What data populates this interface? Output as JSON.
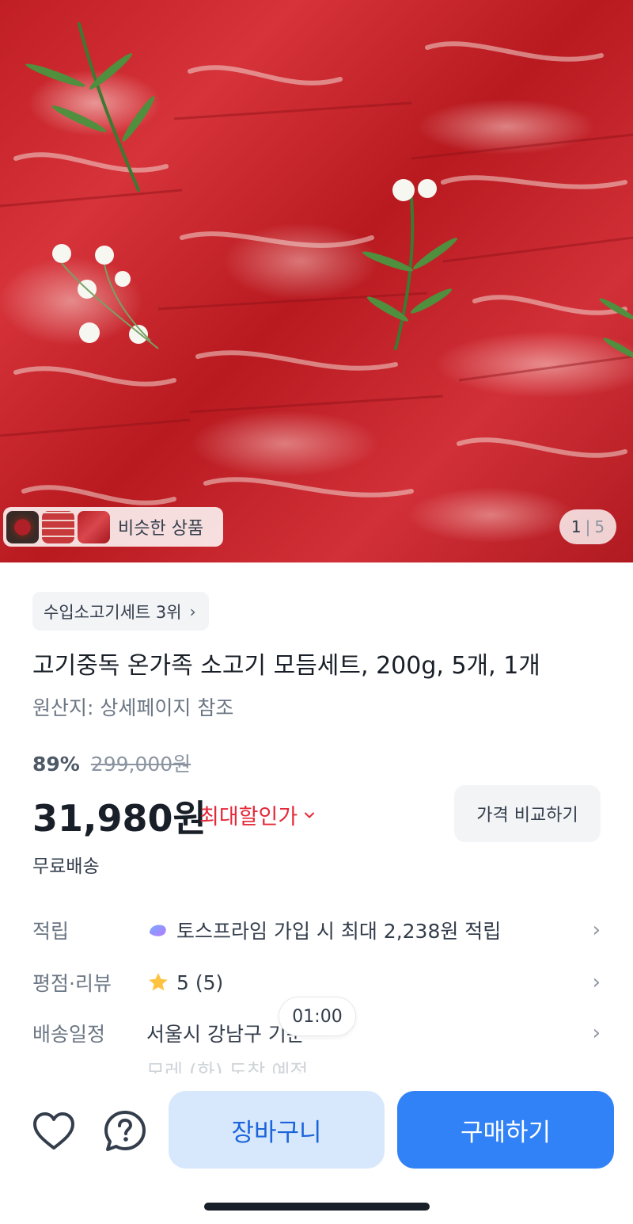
{
  "gallery": {
    "similar_label": "비슷한 상품",
    "current_page": "1",
    "separator": "|",
    "total_pages": "5"
  },
  "product": {
    "rank_badge": "수입소고기세트 3위",
    "title": "고기중독 온가족 소고기 모듬세트, 200g, 5개, 1개",
    "origin": "원산지: 상세페이지 참조",
    "discount_percent": "89%",
    "original_price": "299,000원",
    "price": "31,980원",
    "max_discount_label": "최대할인가",
    "compare_button": "가격 비교하기",
    "shipping": "무료배송"
  },
  "info_rows": {
    "points": {
      "label": "적립",
      "value": "토스프라임 가입 시 최대 2,238원 적립"
    },
    "rating": {
      "label": "평점·리뷰",
      "value": "5 (5)"
    },
    "delivery": {
      "label": "배송일정",
      "value": "서울시 강남구 기준",
      "sub": "모레 (화) 도착 예정"
    }
  },
  "timer": "01:00",
  "actions": {
    "wishlist_icon": "heart-icon",
    "inquiry_icon": "question-bubble-icon",
    "cart_label": "장바구니",
    "buy_label": "구매하기"
  },
  "colors": {
    "accent": "#3182f6",
    "cart_bg": "#d8e8fc",
    "discount_red": "#e42939",
    "star": "#ffc342"
  }
}
